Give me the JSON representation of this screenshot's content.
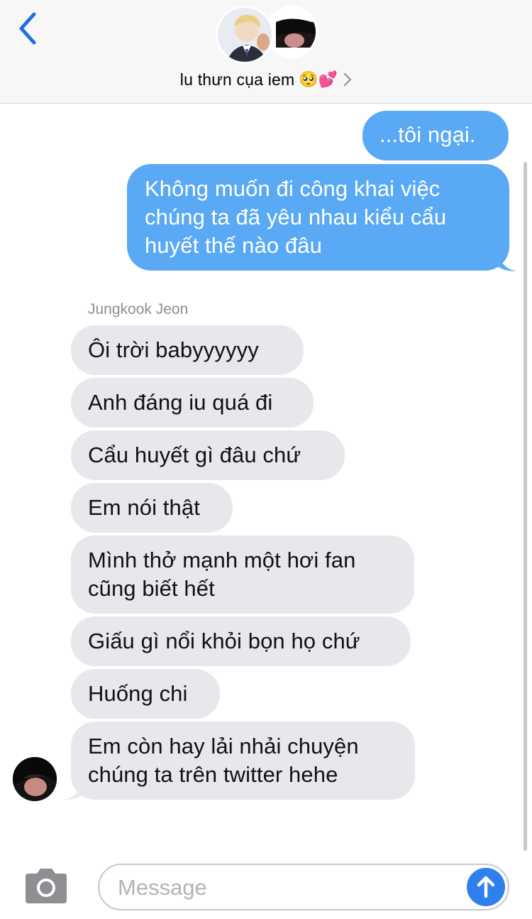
{
  "header": {
    "contact_name": "lu thưn cụa iem",
    "contact_emoji": "🥺💕"
  },
  "conversation": {
    "sent": [
      {
        "text": "...tôi ngại."
      },
      {
        "text": "Không muốn đi công khai việc chúng ta đã yêu nhau kiểu cẩu huyết thế nào đâu"
      }
    ],
    "sender_name": "Jungkook Jeon",
    "received": [
      {
        "text": "Ôi trời babyyyyyy"
      },
      {
        "text": "Anh đáng iu quá đi"
      },
      {
        "text": "Cẩu huyết gì đâu chứ"
      },
      {
        "text": "Em nói thật"
      },
      {
        "text": "Mình thở mạnh một hơi fan cũng biết hết"
      },
      {
        "text": "Giấu gì nổi khỏi bọn họ chứ"
      },
      {
        "text": "Huống chi"
      },
      {
        "text": "Em còn hay lải nhải chuyện chúng ta trên twitter hehe"
      }
    ]
  },
  "input": {
    "placeholder": "Message"
  },
  "colors": {
    "sent_bubble": "#5aa9f4",
    "received_bubble": "#e8e8ec",
    "accent": "#2f80ed"
  },
  "icons": [
    "back-chevron-icon",
    "camera-icon",
    "send-arrow-icon",
    "chevron-right-icon"
  ]
}
